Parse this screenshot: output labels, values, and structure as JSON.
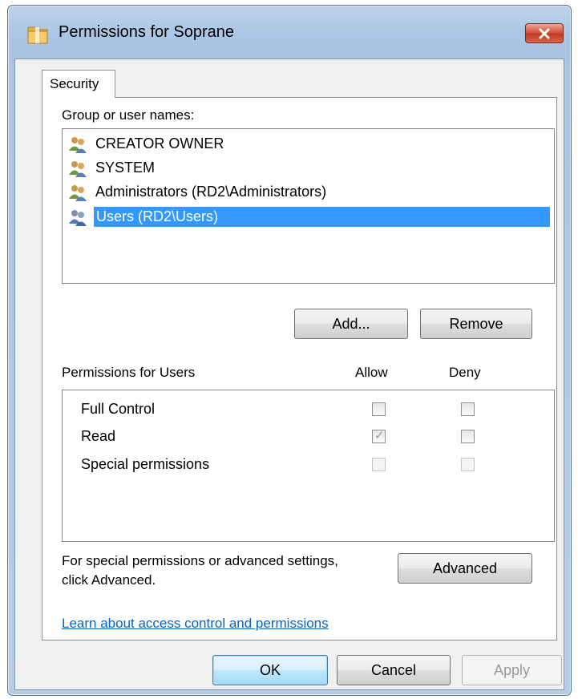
{
  "window": {
    "title": "Permissions for Soprane",
    "folder_icon": "folder-icon",
    "close_icon": "close-icon"
  },
  "tabs": [
    {
      "label": "Security",
      "selected": true
    }
  ],
  "group_section": {
    "label": "Group or user names:",
    "items": [
      {
        "label": "CREATOR OWNER",
        "icon": "users-icon",
        "selected": false
      },
      {
        "label": "SYSTEM",
        "icon": "users-icon",
        "selected": false
      },
      {
        "label": "Administrators (RD2\\Administrators)",
        "icon": "users-icon",
        "selected": false
      },
      {
        "label": "Users (RD2\\Users)",
        "icon": "users-icon",
        "selected": true
      }
    ],
    "add_label": "Add...",
    "remove_label": "Remove"
  },
  "permissions": {
    "label": "Permissions for Users",
    "allow_header": "Allow",
    "deny_header": "Deny",
    "rows": [
      {
        "name": "Full Control",
        "allow": false,
        "deny": false,
        "disabled": false
      },
      {
        "name": "Read",
        "allow": true,
        "deny": false,
        "disabled": false
      },
      {
        "name": "Special permissions",
        "allow": false,
        "deny": false,
        "disabled": true
      }
    ]
  },
  "advanced": {
    "text_line1": "For special permissions or advanced settings,",
    "text_line2": "click Advanced.",
    "button_label": "Advanced"
  },
  "learn_link": "Learn about access control and permissions",
  "footer": {
    "ok_label": "OK",
    "cancel_label": "Cancel",
    "apply_label": "Apply"
  },
  "colors": {
    "selection": "#3399ff",
    "link": "#0066cc",
    "close_button": "#c7432b"
  }
}
